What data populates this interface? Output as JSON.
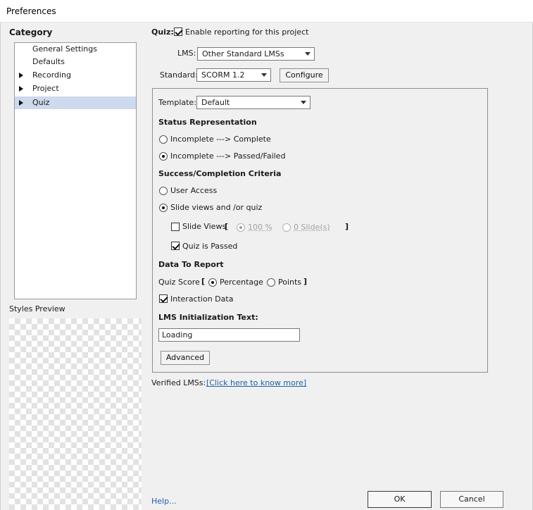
{
  "window": {
    "title": "Preferences"
  },
  "category": {
    "label": "Category",
    "items": [
      {
        "label": "General Settings",
        "expandable": false,
        "selected": false
      },
      {
        "label": "Defaults",
        "expandable": false,
        "selected": false
      },
      {
        "label": "Recording",
        "expandable": true,
        "selected": false
      },
      {
        "label": "Project",
        "expandable": true,
        "selected": false
      },
      {
        "label": "Quiz",
        "expandable": true,
        "selected": true
      }
    ]
  },
  "styles_preview": {
    "label": "Styles Preview"
  },
  "quiz": {
    "label": "Quiz:",
    "enable_reporting_label": "Enable reporting for this project",
    "enable_reporting_checked": true,
    "lms_label": "LMS:",
    "lms_value": "Other Standard LMSs",
    "standard_label": "Standard:",
    "standard_value": "SCORM 1.2",
    "configure_label": "Configure",
    "template_label": "Template:",
    "template_value": "Default",
    "status_heading": "Status Representation",
    "status_options": [
      "Incomplete ---> Complete",
      "Incomplete ---> Passed/Failed"
    ],
    "status_selected": 1,
    "criteria_heading": "Success/Completion Criteria",
    "criteria_options": [
      "User Access",
      "Slide views and /or quiz"
    ],
    "criteria_selected": 1,
    "slide_views_label": "Slide Views",
    "slide_views_checked": false,
    "bracket_open": "[",
    "bracket_close": "]",
    "percent_value": "100 %",
    "slides_value": "0 Slide(s)",
    "quiz_passed_label": "Quiz is Passed",
    "quiz_passed_checked": true,
    "data_heading": "Data To Report",
    "quiz_score_label": "Quiz Score",
    "score_options": [
      "Percentage",
      "Points"
    ],
    "score_selected": 0,
    "interaction_label": "Interaction Data",
    "interaction_checked": true,
    "init_text_label": "LMS Initialization Text:",
    "init_text_value": "Loading",
    "advanced_label": "Advanced",
    "verified_label": "Verified LMSs:",
    "verified_link": "[Click here to know more]"
  },
  "footer": {
    "help_label": "Help...",
    "ok_label": "OK",
    "cancel_label": "Cancel"
  }
}
